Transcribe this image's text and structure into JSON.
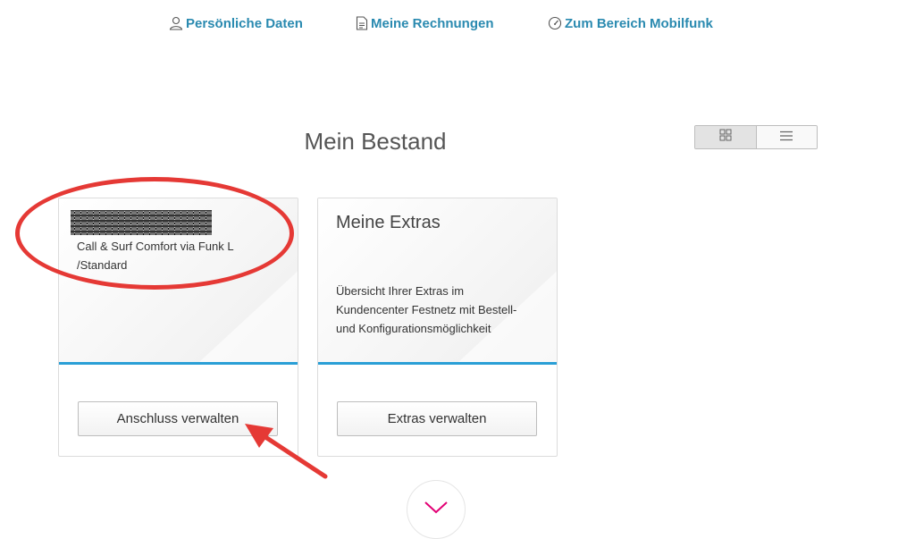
{
  "nav": {
    "personal": {
      "label": "Persönliche Daten",
      "icon": "person-icon"
    },
    "invoices": {
      "label": "Meine Rechnungen",
      "icon": "document-icon"
    },
    "mobile": {
      "label": "Zum Bereich Mobilfunk",
      "icon": "speedometer-icon"
    }
  },
  "page_title": "Mein Bestand",
  "view_toggle": {
    "grid_icon": "grid-icon",
    "list_icon": "list-icon"
  },
  "cards": [
    {
      "product_line1": "Call & Surf Comfort via Funk L",
      "product_line2": "/Standard",
      "button_label": "Anschluss verwalten"
    },
    {
      "heading": "Meine Extras",
      "desc_line1": "Übersicht Ihrer Extras im",
      "desc_line2": "Kundencenter Festnetz mit Bestell-",
      "desc_line3": "und Konfigurationsmöglichkeit",
      "button_label": "Extras verwalten"
    }
  ],
  "colors": {
    "link": "#2a8ab0",
    "accent_line": "#2a9fd6",
    "annotation": "#e53935",
    "chevron": "#e20074"
  }
}
